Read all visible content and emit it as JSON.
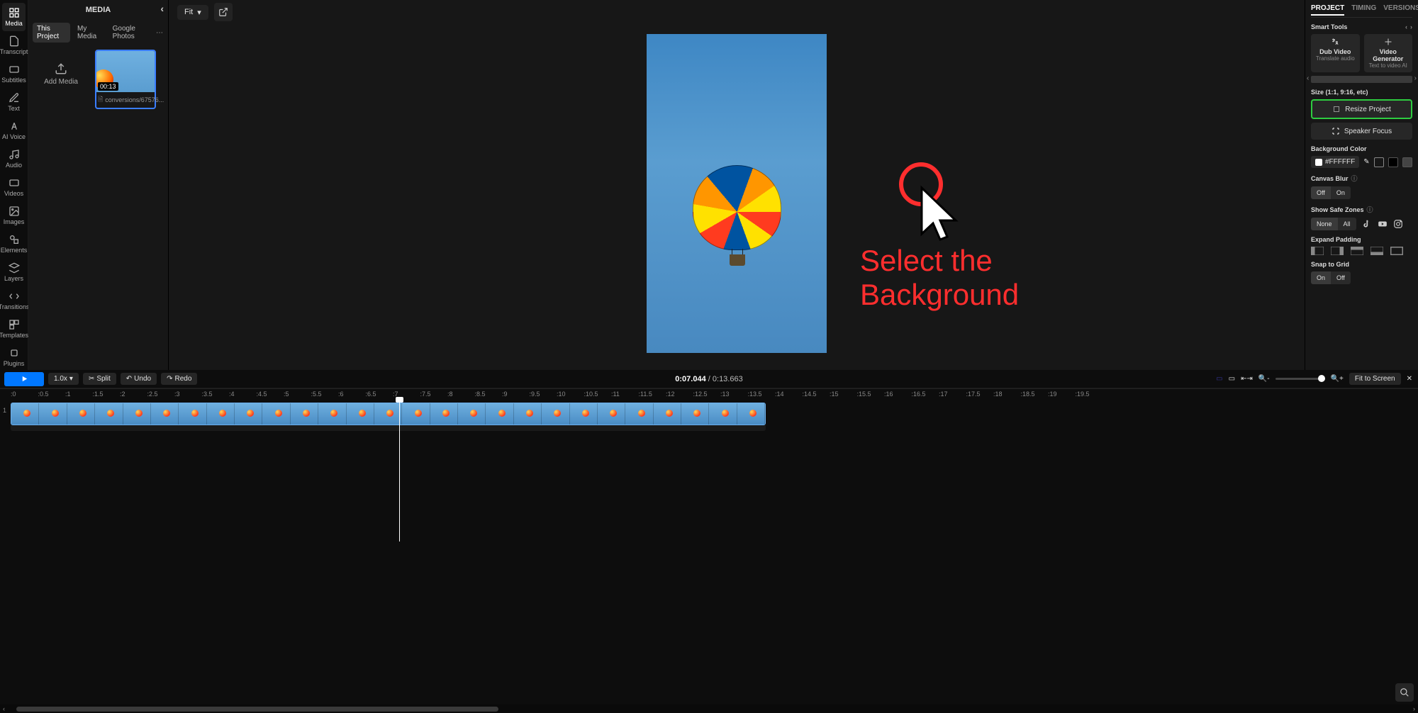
{
  "leftRail": {
    "items": [
      {
        "label": "Media",
        "icon": "grid"
      },
      {
        "label": "Transcript",
        "icon": "doc"
      },
      {
        "label": "Subtitles",
        "icon": "cc"
      },
      {
        "label": "Text",
        "icon": "pencil"
      },
      {
        "label": "AI Voice",
        "icon": "mic"
      },
      {
        "label": "Audio",
        "icon": "note"
      },
      {
        "label": "Videos",
        "icon": "video"
      },
      {
        "label": "Images",
        "icon": "image"
      },
      {
        "label": "Elements",
        "icon": "shapes"
      },
      {
        "label": "Layers",
        "icon": "layers"
      },
      {
        "label": "Transitions",
        "icon": "trans"
      },
      {
        "label": "Templates",
        "icon": "templ"
      },
      {
        "label": "Plugins",
        "icon": "plug"
      }
    ]
  },
  "mediaPanel": {
    "title": "MEDIA",
    "tabs": [
      "This Project",
      "My Media",
      "Google Photos"
    ],
    "addMedia": "Add Media",
    "clipDuration": "00:13",
    "clipName": "conversions/67576..."
  },
  "canvas": {
    "fitLabel": "Fit",
    "annotationLine1": "Select the",
    "annotationLine2": "Background"
  },
  "rightPanel": {
    "tabs": [
      "PROJECT",
      "TIMING",
      "VERSIONS"
    ],
    "smartTools": "Smart Tools",
    "dubT1": "Dub Video",
    "dubT2": "Translate audio",
    "genT1": "Video Generator",
    "genT2": "Text to video AI",
    "sizeLabel": "Size (1:1, 9:16, etc)",
    "resize": "Resize Project",
    "speakerFocus": "Speaker Focus",
    "bgColorLabel": "Background Color",
    "bgColorHex": "#FFFFFF",
    "canvasBlur": "Canvas Blur",
    "off": "Off",
    "on": "On",
    "safeZones": "Show Safe Zones",
    "none": "None",
    "all": "All",
    "expandPadding": "Expand Padding",
    "snapGrid": "Snap to Grid"
  },
  "timeline": {
    "speed": "1.0x",
    "split": "Split",
    "undo": "Undo",
    "redo": "Redo",
    "current": "0:07.044",
    "total": "0:13.663",
    "fitToScreen": "Fit to Screen",
    "ticks": [
      ":0",
      ":0.5",
      ":1",
      ":1.5",
      ":2",
      ":2.5",
      ":3",
      ":3.5",
      ":4",
      ":4.5",
      ":5",
      ":5.5",
      ":6",
      ":6.5",
      ":7",
      ":7.5",
      ":8",
      ":8.5",
      ":9",
      ":9.5",
      ":10",
      ":10.5",
      ":11",
      ":11.5",
      ":12",
      ":12.5",
      ":13",
      ":13.5",
      ":14",
      ":14.5",
      ":15",
      ":15.5",
      ":16",
      ":16.5",
      ":17",
      ":17.5",
      ":18",
      ":18.5",
      ":19",
      ":19.5"
    ],
    "trackNum": "1"
  }
}
